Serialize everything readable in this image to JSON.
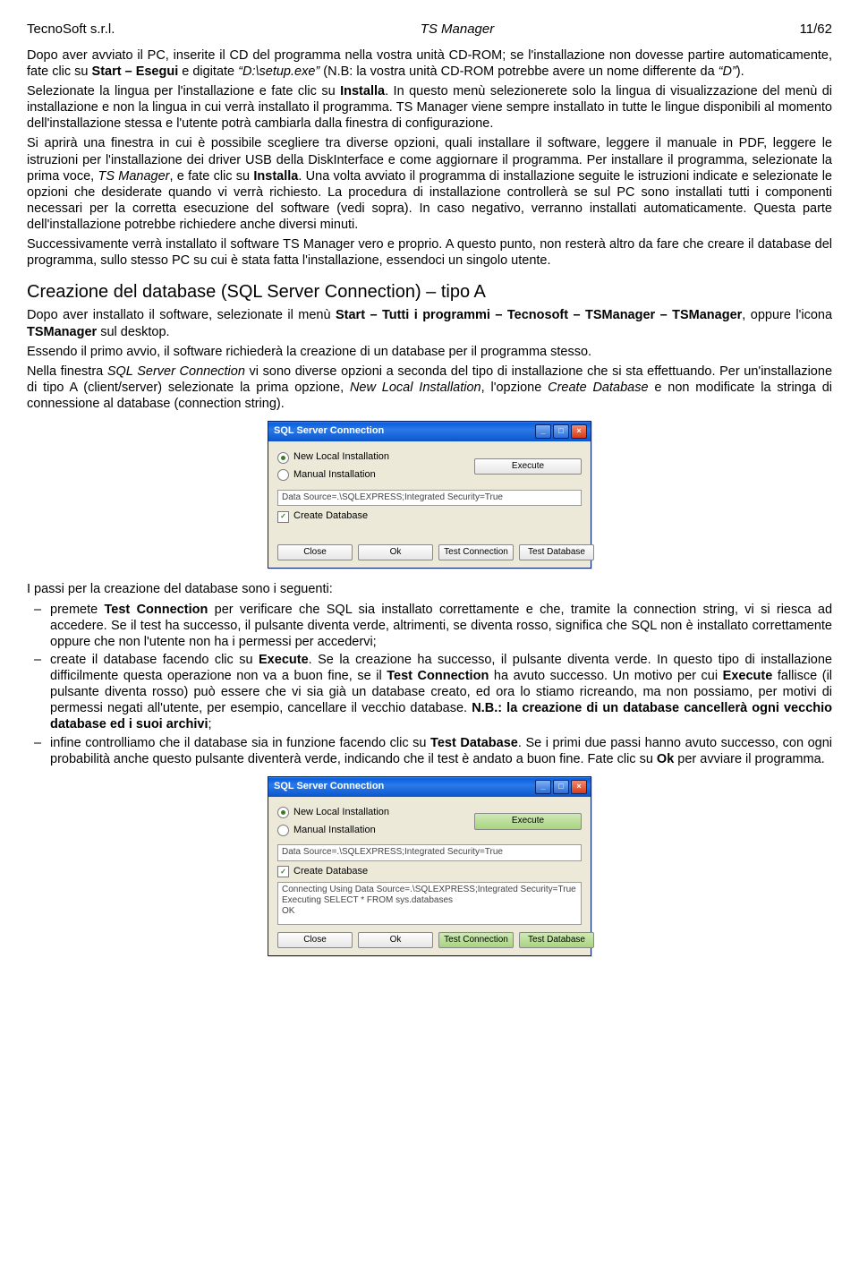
{
  "header": {
    "company": "TecnoSoft s.r.l.",
    "doc": "TS Manager",
    "page": "11/62"
  },
  "p1": "Dopo aver avviato il PC, inserite il CD del programma nella vostra unità CD-ROM; se l'installazione non dovesse partire automaticamente, fate clic su ",
  "p1b": "Start – Esegui",
  "p1c": " e digitate ",
  "p1d": "“D:\\setup.exe”",
  "p1e": " (N.B: la vostra unità CD-ROM potrebbe avere un nome differente da ",
  "p1f": "“D”",
  "p1g": ").",
  "p2a": "Selezionate la lingua per l'installazione e fate clic su ",
  "p2b": "Installa",
  "p2c": ". In questo menù selezionerete solo la lingua di visualizzazione del menù di installazione e non la lingua in cui verrà installato il programma. TS Manager viene sempre installato in tutte le lingue disponibili al momento dell'installazione stessa e l'utente potrà cambiarla dalla finestra di configurazione.",
  "p3a": "Si aprirà una finestra in cui è possibile scegliere tra diverse opzioni, quali installare il software, leggere il manuale in PDF, leggere le istruzioni per l'installazione dei driver USB della DiskInterface e come aggiornare il programma. Per installare il programma, selezionate la prima voce, ",
  "p3b": "TS Manager",
  "p3c": ", e fate clic su ",
  "p3d": "Installa",
  "p3e": ". Una volta avviato il programma di installazione seguite le istruzioni indicate e selezionate le opzioni che desiderate quando vi verrà richiesto. La procedura di installazione controllerà se sul PC sono installati tutti i componenti necessari per la corretta esecuzione del software (vedi sopra). In caso negativo, verranno installati automaticamente. Questa parte dell'installazione potrebbe richiedere anche diversi minuti.",
  "p4": "Successivamente verrà installato il software TS Manager vero e proprio. A questo punto, non resterà altro da fare che creare il database del programma, sullo stesso PC su cui è stata fatta l'installazione, essendoci un singolo utente.",
  "h1": "Creazione del database (SQL Server Connection) – tipo A",
  "p5a": "Dopo aver installato il software, selezionate il menù ",
  "p5b": "Start – Tutti i programmi – Tecnosoft – TSManager – TSManager",
  "p5c": ", oppure l'icona ",
  "p5d": "TSManager",
  "p5e": " sul desktop.",
  "p6": "Essendo il primo avvio, il software richiederà la creazione di un database per il programma stesso.",
  "p7a": "Nella finestra ",
  "p7b": "SQL Server Connection",
  "p7c": " vi sono diverse opzioni a seconda del tipo di installazione che si sta effettuando. Per un'installazione di tipo A (client/server) selezionate la prima opzione, ",
  "p7d": "New Local Installation",
  "p7e": ", l'opzione ",
  "p7f": "Create Database",
  "p7g": " e non modificate la stringa di connessione al database (connection string).",
  "dialog": {
    "title": "SQL Server Connection",
    "opt1": "New Local Installation",
    "opt2": "Manual Installation",
    "execBtn": "Execute",
    "conn": "Data Source=.\\SQLEXPRESS;Integrated Security=True",
    "createDb": "Create Database",
    "close": "Close",
    "ok": "Ok",
    "testConn": "Test Connection",
    "testDb": "Test Database",
    "logLine1": "Connecting Using Data Source=.\\SQLEXPRESS;Integrated Security=True",
    "logLine2": "Executing SELECT * FROM sys.databases",
    "logLine3": "OK"
  },
  "p8": "I passi per la creazione del database sono i seguenti:",
  "li1a": "premete ",
  "li1b": "Test Connection",
  "li1c": " per verificare che SQL sia installato correttamente e che, tramite la connection string, vi si riesca ad accedere. Se il test ha successo, il pulsante diventa verde, altrimenti, se diventa rosso, significa che SQL non è installato correttamente oppure che non l'utente non ha i permessi per accedervi;",
  "li2a": "create il database facendo clic su ",
  "li2b": "Execute",
  "li2c": ". Se la creazione ha successo, il pulsante diventa verde. In questo tipo di installazione difficilmente questa operazione non va a buon fine, se il ",
  "li2d": "Test Connection",
  "li2e": " ha avuto successo. Un motivo per cui ",
  "li2f": "Execute",
  "li2g": " fallisce (il pulsante diventa rosso) può essere che vi sia già un database creato, ed ora lo stiamo ricreando, ma non possiamo, per motivi di permessi negati all'utente, per esempio, cancellare il vecchio database. ",
  "li2h": "N.B.: la creazione di un database cancellerà ogni vecchio database ed i suoi archivi",
  "li2i": ";",
  "li3a": "infine controlliamo che il database sia in funzione facendo clic su ",
  "li3b": "Test Database",
  "li3c": ". Se i primi due passi hanno avuto successo, con ogni probabilità anche questo pulsante diventerà verde, indicando che il test è andato a buon fine. Fate clic su ",
  "li3d": "Ok",
  "li3e": " per avviare il programma."
}
